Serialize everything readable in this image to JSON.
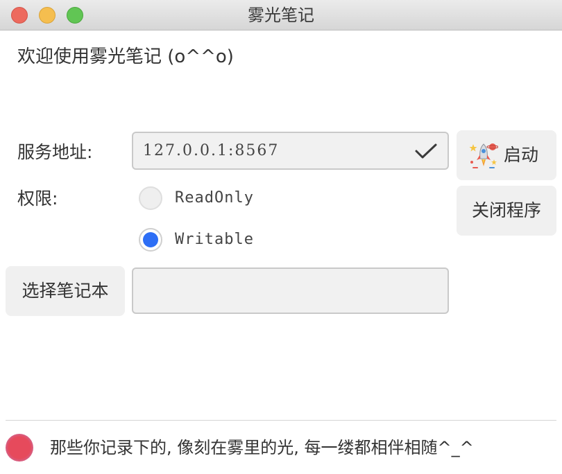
{
  "window": {
    "title": "雾光笔记"
  },
  "welcome": {
    "text": "欢迎使用雾光笔记 (o^^o)"
  },
  "server": {
    "label": "服务地址:",
    "value": "127.0.0.1:8567",
    "check_icon": "checkmark-icon"
  },
  "permission": {
    "label": "权限:",
    "options": [
      {
        "label": "ReadOnly",
        "selected": false
      },
      {
        "label": "Writable",
        "selected": true
      }
    ]
  },
  "buttons": {
    "start_label": "启动",
    "start_icon": "rocket-icon",
    "close_label": "关闭程序",
    "choose_notebook_label": "选择笔记本"
  },
  "notebook": {
    "value": ""
  },
  "status": {
    "text": "那些你记录下的, 像刻在雾里的光, 每一缕都相伴相随^_^",
    "dot_color": "#e64a5c"
  },
  "colors": {
    "accent": "#2d6ef5",
    "button_bg": "#f0f0f0",
    "input_bg": "#f1f1f1"
  }
}
